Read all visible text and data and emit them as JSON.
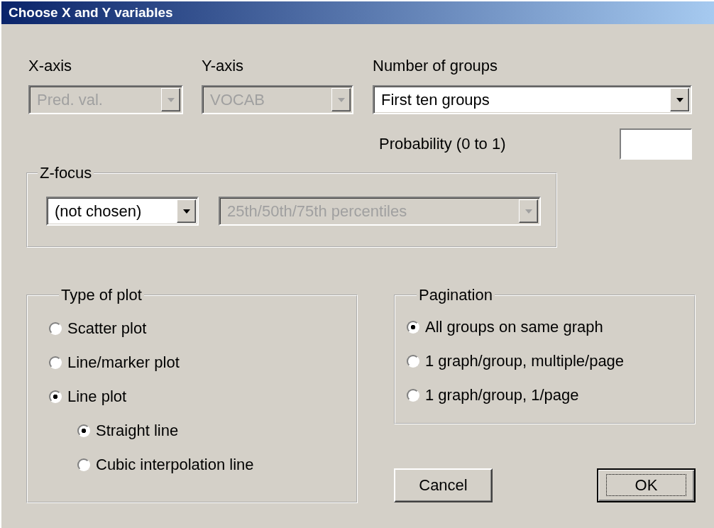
{
  "window": {
    "title": "Choose X and Y variables"
  },
  "x_axis": {
    "label": "X-axis",
    "value": "Pred. val.",
    "disabled": true
  },
  "y_axis": {
    "label": "Y-axis",
    "value": "VOCAB",
    "disabled": true
  },
  "groups": {
    "label": "Number of groups",
    "value": "First ten groups",
    "disabled": false
  },
  "probability": {
    "label": "Probability (0 to 1)"
  },
  "z_focus": {
    "title": "Z-focus",
    "dropdowns": [
      {
        "value": "(not chosen)",
        "disabled": false
      },
      {
        "value": "25th/50th/75th percentiles",
        "disabled": true
      }
    ]
  },
  "plot_type": {
    "title": "Type of plot",
    "options": [
      {
        "label": "Scatter plot",
        "selected": false
      },
      {
        "label": "Line/marker plot",
        "selected": false
      },
      {
        "label": "Line plot",
        "selected": true,
        "children": [
          {
            "label": "Straight line",
            "selected": true
          },
          {
            "label": "Cubic interpolation line",
            "selected": false
          }
        ]
      }
    ]
  },
  "pagination": {
    "title": "Pagination",
    "options": [
      {
        "label": "All groups on same graph",
        "selected": true
      },
      {
        "label": "1 graph/group, multiple/page",
        "selected": false
      },
      {
        "label": "1 graph/group, 1/page",
        "selected": false
      }
    ]
  },
  "buttons": [
    {
      "label": "Cancel",
      "focused": false
    },
    {
      "label": "OK",
      "focused": true
    }
  ]
}
